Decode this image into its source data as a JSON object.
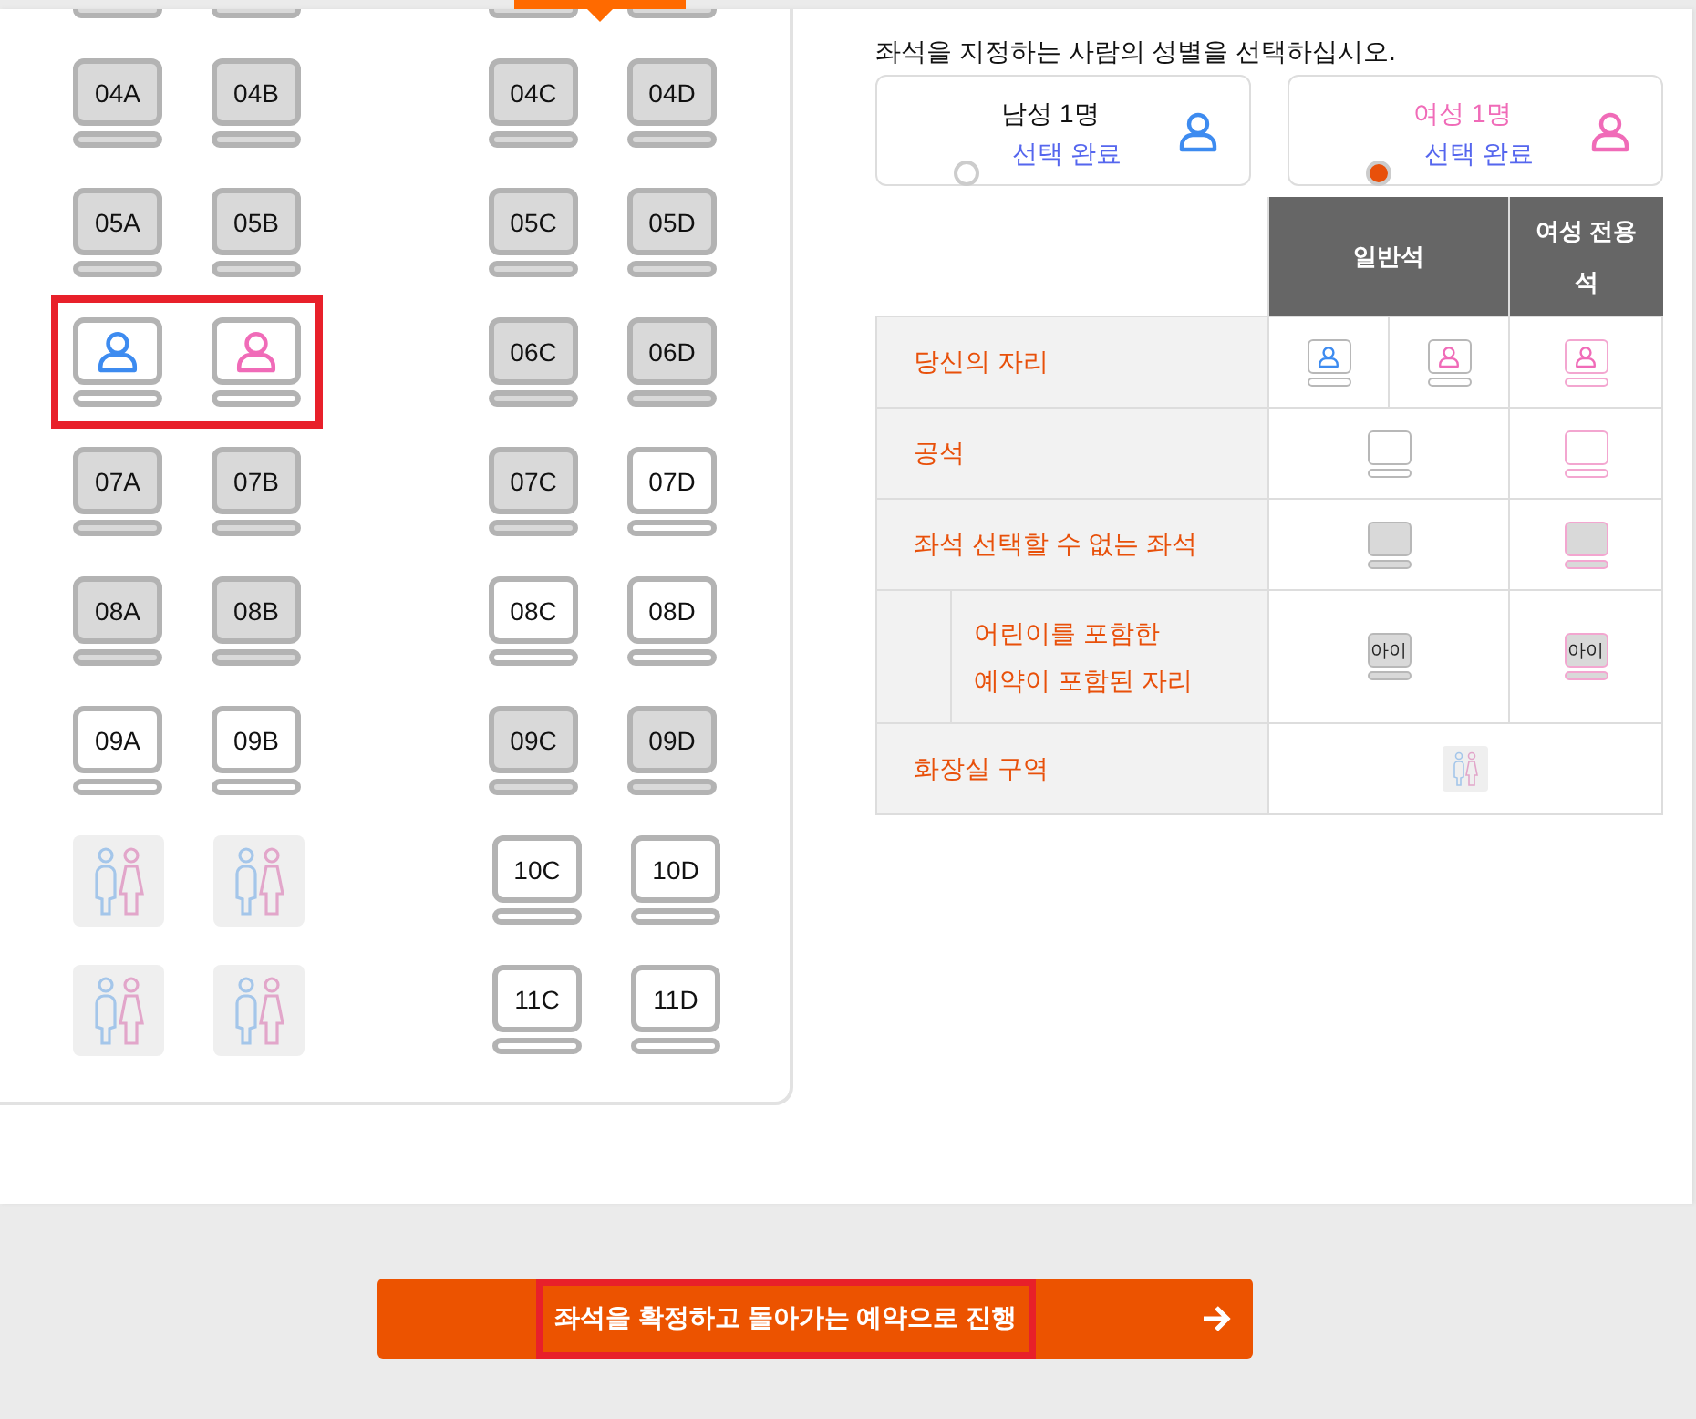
{
  "seat_map": {
    "rows": [
      {
        "highlighted": false,
        "left": [
          {
            "kind": "occupied"
          },
          {
            "kind": "occupied"
          }
        ],
        "right": [
          {
            "kind": "occupied"
          },
          {
            "kind": "occupied"
          }
        ]
      },
      {
        "highlighted": false,
        "left": [
          {
            "kind": "occupied",
            "label": "04A"
          },
          {
            "kind": "occupied",
            "label": "04B"
          }
        ],
        "right": [
          {
            "kind": "occupied",
            "label": "04C"
          },
          {
            "kind": "occupied",
            "label": "04D"
          }
        ]
      },
      {
        "highlighted": false,
        "left": [
          {
            "kind": "occupied",
            "label": "05A"
          },
          {
            "kind": "occupied",
            "label": "05B"
          }
        ],
        "right": [
          {
            "kind": "occupied",
            "label": "05C"
          },
          {
            "kind": "occupied",
            "label": "05D"
          }
        ]
      },
      {
        "highlighted": true,
        "left": [
          {
            "kind": "mine",
            "color": "#3d8bf0"
          },
          {
            "kind": "mine",
            "color": "#f06bb8"
          }
        ],
        "right": [
          {
            "kind": "occupied",
            "label": "06C"
          },
          {
            "kind": "occupied",
            "label": "06D"
          }
        ]
      },
      {
        "highlighted": false,
        "left": [
          {
            "kind": "occupied",
            "label": "07A"
          },
          {
            "kind": "occupied",
            "label": "07B"
          }
        ],
        "right": [
          {
            "kind": "occupied",
            "label": "07C"
          },
          {
            "kind": "available",
            "label": "07D"
          }
        ]
      },
      {
        "highlighted": false,
        "left": [
          {
            "kind": "occupied",
            "label": "08A"
          },
          {
            "kind": "occupied",
            "label": "08B"
          }
        ],
        "right": [
          {
            "kind": "available",
            "label": "08C"
          },
          {
            "kind": "available",
            "label": "08D"
          }
        ]
      },
      {
        "highlighted": false,
        "left": [
          {
            "kind": "available",
            "label": "09A"
          },
          {
            "kind": "available",
            "label": "09B"
          }
        ],
        "right": [
          {
            "kind": "occupied",
            "label": "09C"
          },
          {
            "kind": "occupied",
            "label": "09D"
          }
        ]
      },
      {
        "highlighted": false,
        "left": [
          {
            "kind": "restroom"
          },
          {
            "kind": "restroom"
          }
        ],
        "right": [
          {
            "kind": "available",
            "label": "10C"
          },
          {
            "kind": "available",
            "label": "10D"
          }
        ]
      },
      {
        "highlighted": false,
        "left": [
          {
            "kind": "restroom"
          },
          {
            "kind": "restroom"
          }
        ],
        "right": [
          {
            "kind": "available",
            "label": "11C"
          },
          {
            "kind": "available",
            "label": "11D"
          }
        ]
      }
    ]
  },
  "gender_prompt": "좌석을 지정하는 사람의 성별을 선택하십시오.",
  "gender_options": [
    {
      "label": "남성 1명",
      "status": "선택 완료",
      "selected": false,
      "color": "#3d8bf0"
    },
    {
      "label": "여성 1명",
      "status": "선택 완료",
      "selected": true,
      "color": "#f06bb8"
    }
  ],
  "legend": {
    "columns": [
      "일반석",
      "여성 전용석"
    ],
    "rows": [
      {
        "kind": "yours",
        "label": "당신의 자리"
      },
      {
        "kind": "empty",
        "label": "공석"
      },
      {
        "kind": "unavailable",
        "label": "좌석 선택할 수 없는 좌석",
        "children": [
          {
            "kind": "child",
            "lines": [
              "어린이를 포함한",
              "예약이 포함된 자리"
            ],
            "general_icon_text": "아이",
            "women_icon_text": "아이"
          }
        ]
      },
      {
        "kind": "restroom",
        "label": "화장실 구역"
      }
    ]
  },
  "confirm_button": {
    "label": "좌석을 확정하고 돌아가는 예약으로 진행",
    "highlighted": true
  }
}
